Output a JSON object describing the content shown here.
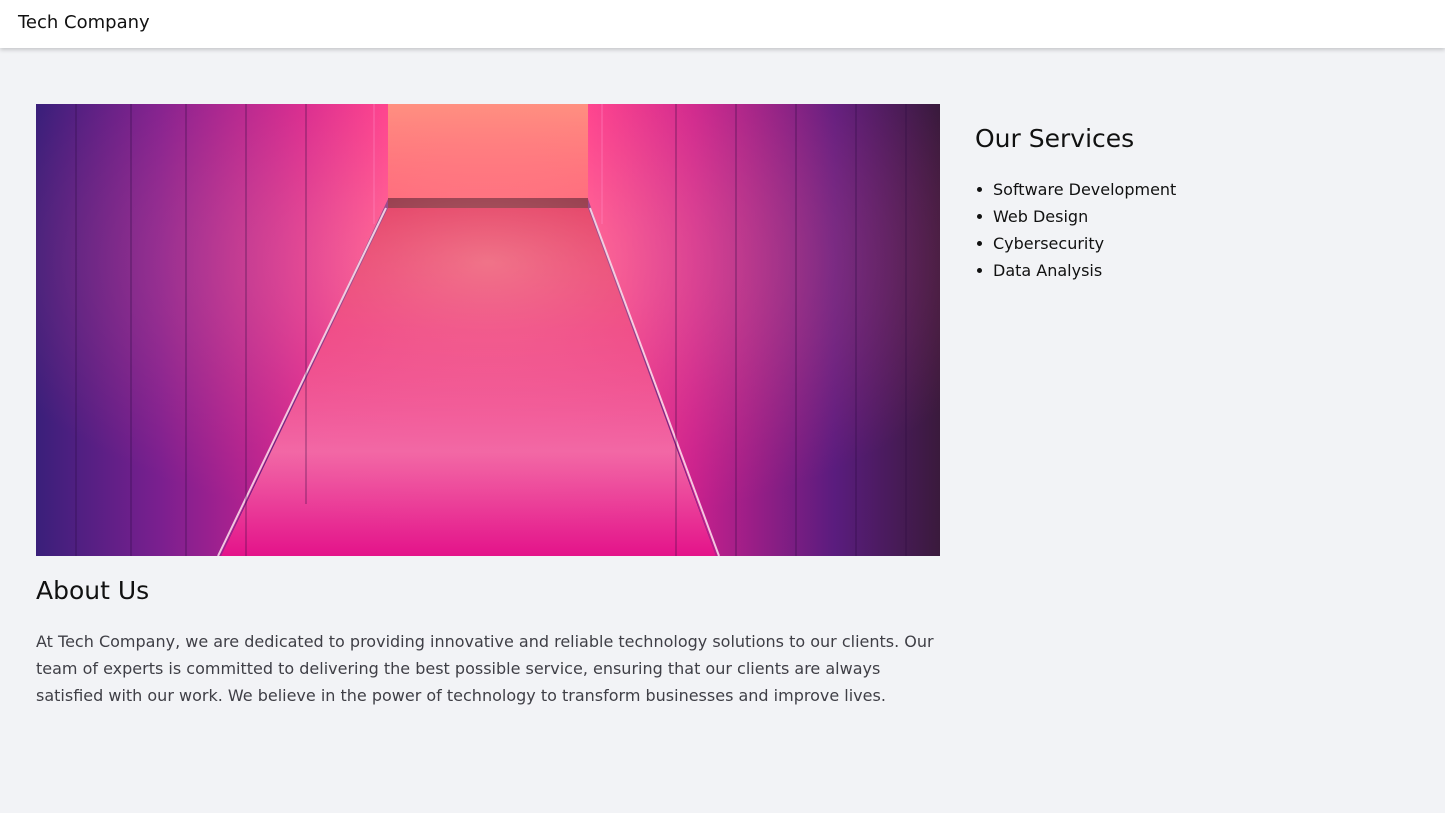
{
  "header": {
    "brand": "Tech Company"
  },
  "about": {
    "title": "About Us",
    "text": "At Tech Company, we are dedicated to providing innovative and reliable technology solutions to our clients. Our team of experts is committed to delivering the best possible service, ensuring that our clients are always satisfied with our work. We believe in the power of technology to transform businesses and improve lives."
  },
  "services": {
    "title": "Our Services",
    "items": [
      "Software Development",
      "Web Design",
      "Cybersecurity",
      "Data Analysis"
    ]
  },
  "colors": {
    "background": "#f2f3f6",
    "header_bg": "#ffffff",
    "body_text": "#3f3f46",
    "heading_text": "#111111"
  }
}
